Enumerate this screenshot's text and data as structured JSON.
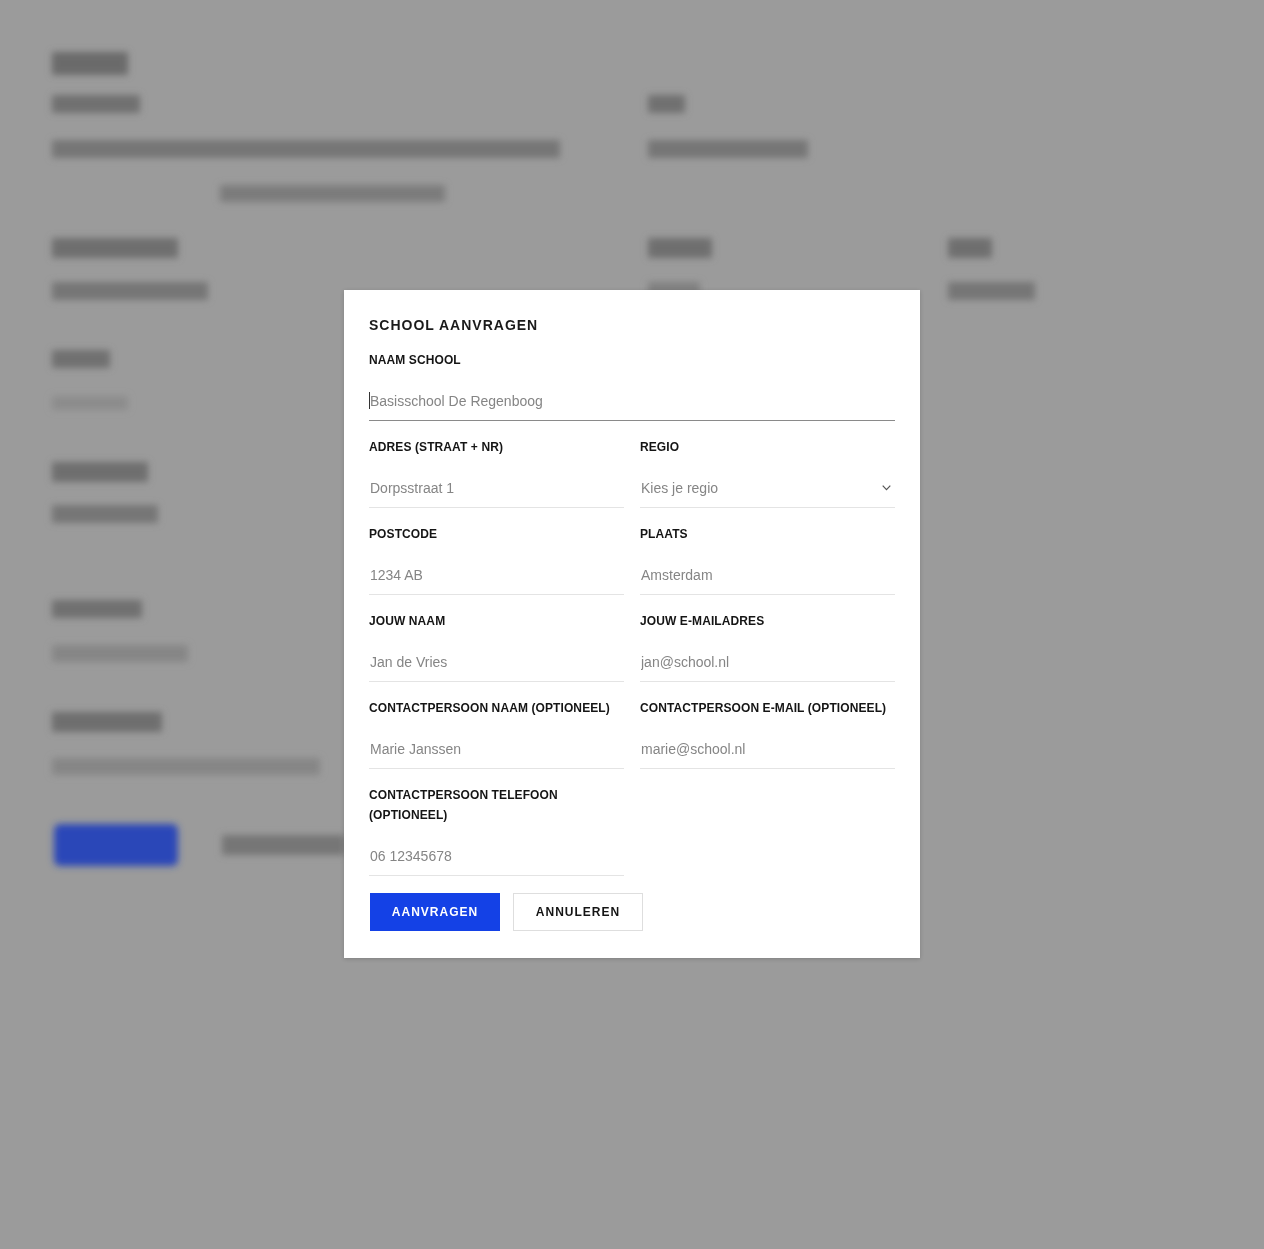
{
  "dialog": {
    "title": "SCHOOL AANVRAGEN",
    "name_field": {
      "kind": "text",
      "label": "NAAM SCHOOL",
      "placeholder": "Basisschool De Regenboog",
      "focused": true
    },
    "fields": [
      {
        "kind": "text",
        "label": "ADRES (STRAAT + NR)",
        "placeholder": "Dorpsstraat 1",
        "focused": false
      },
      {
        "kind": "select",
        "label": "REGIO",
        "placeholder": "Kies je regio",
        "focused": false
      },
      {
        "kind": "text",
        "label": "POSTCODE",
        "placeholder": "1234 AB",
        "focused": false
      },
      {
        "kind": "text",
        "label": "PLAATS",
        "placeholder": "Amsterdam",
        "focused": false
      },
      {
        "kind": "text",
        "label": "JOUW NAAM",
        "placeholder": "Jan de Vries",
        "focused": false
      },
      {
        "kind": "text",
        "label": "JOUW E-MAILADRES",
        "placeholder": "jan@school.nl",
        "focused": false
      },
      {
        "kind": "text",
        "label": "CONTACTPERSOON NAAM (OPTIONEEL)",
        "placeholder": "Marie Janssen",
        "focused": false
      },
      {
        "kind": "text",
        "label": "CONTACTPERSOON E-MAIL (OPTIONEEL)",
        "placeholder": "marie@school.nl",
        "focused": false
      },
      {
        "kind": "text",
        "label": "CONTACTPERSOON TELEFOON (OPTIONEEL)",
        "placeholder": "06 12345678",
        "focused": false
      }
    ],
    "buttons": [
      {
        "kind": "primary",
        "label": "AANVRAGEN"
      },
      {
        "kind": "secondary",
        "label": "ANNULEREN"
      }
    ]
  }
}
